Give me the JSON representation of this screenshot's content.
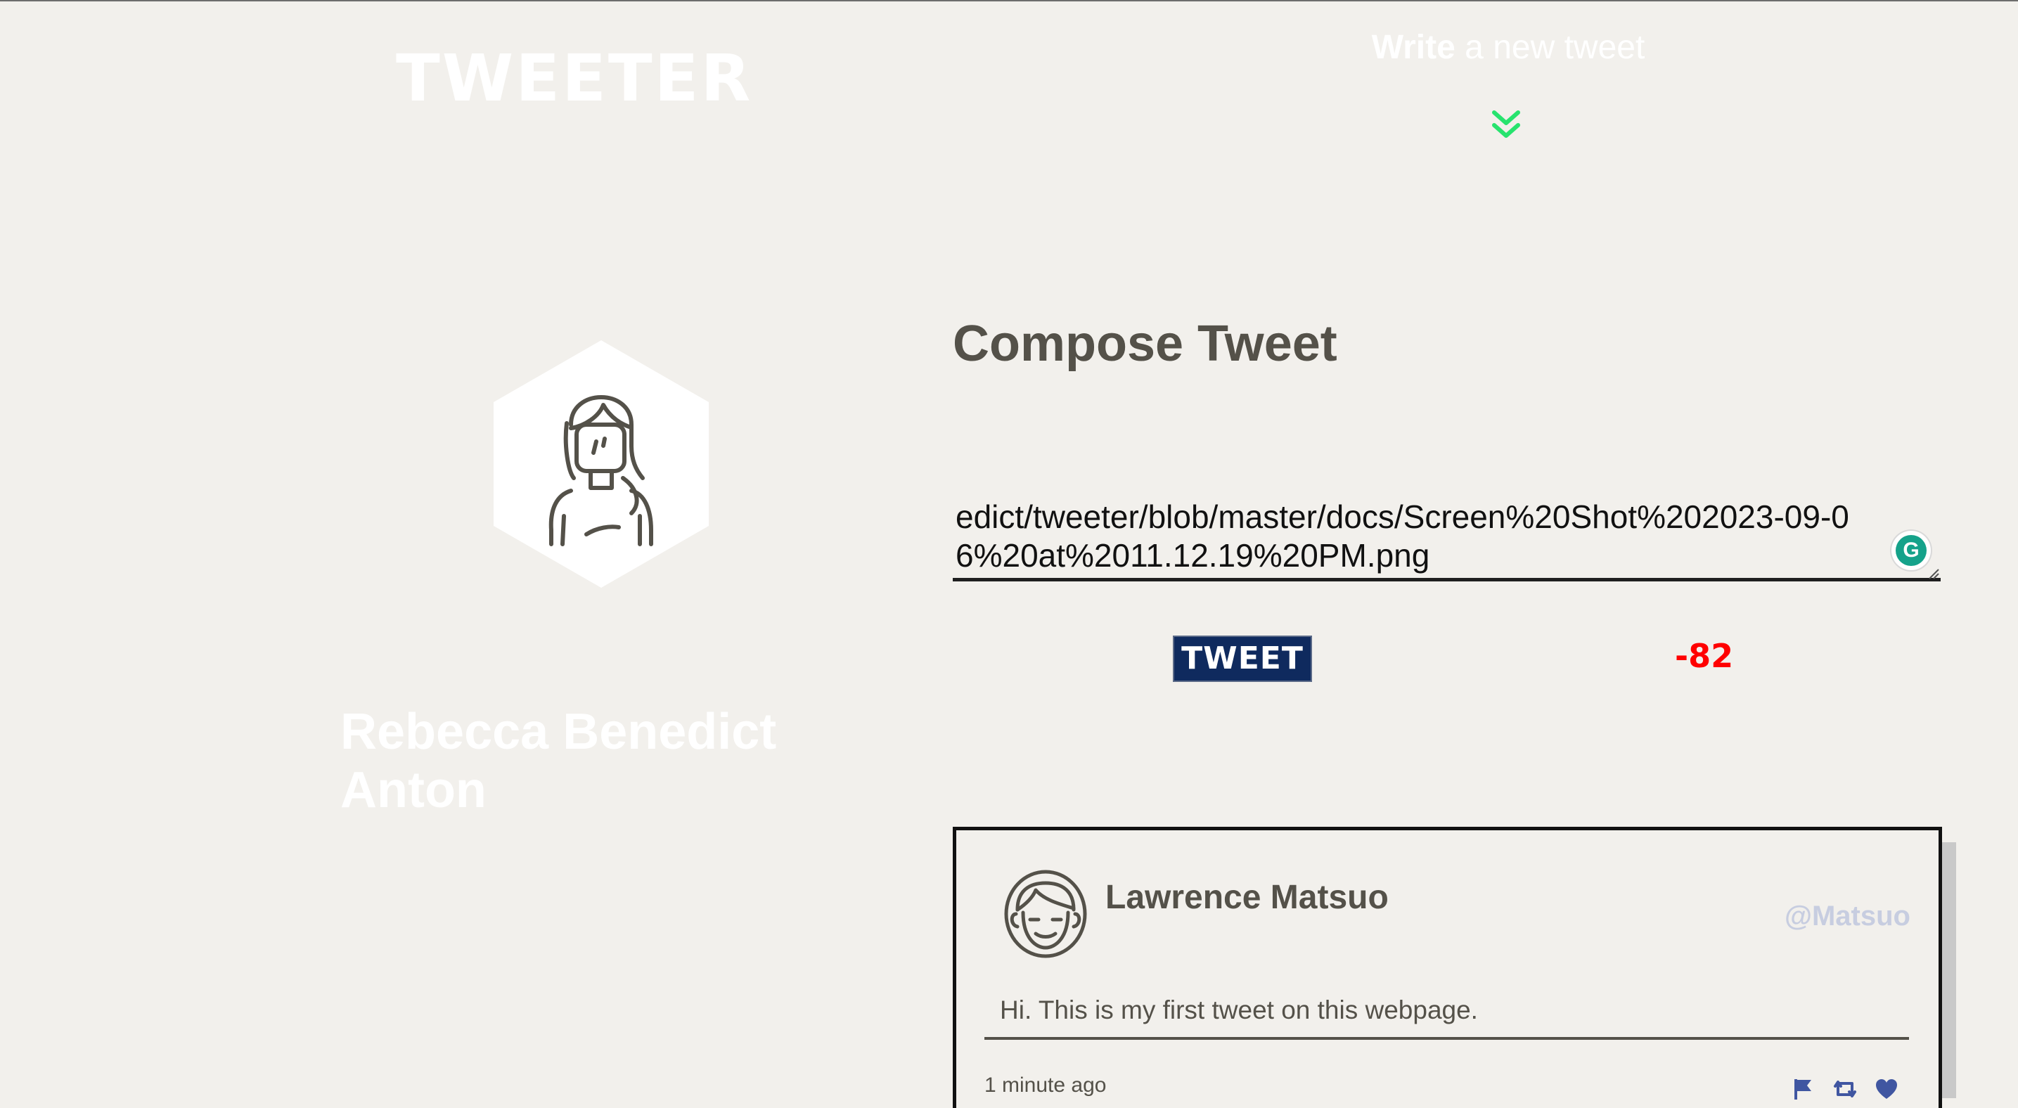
{
  "header": {
    "brand": "TWEETER",
    "write_prefix": "Write",
    "write_rest": " a new tweet",
    "chevron_icon": "double-chevron-down-icon",
    "chevron_color": "#27e36e"
  },
  "profile": {
    "name": "Rebecca Benedict Anton",
    "avatar_icon": "woman-avatar-icon"
  },
  "compose": {
    "title": "Compose Tweet",
    "textarea_value": "edict/tweeter/blob/master/docs/Screen%20Shot%202023-09-06%20at%2011.12.19%20PM.png",
    "button_label": "TWEET",
    "counter": "-82",
    "counter_color": "#ff0000",
    "grammarly_icon": "grammarly-icon",
    "grammarly_glyph": "G"
  },
  "tweets": [
    {
      "author": "Lawrence Matsuo",
      "handle": "@Matsuo",
      "content": "Hi. This is my first tweet on this webpage.",
      "time_ago": "1 minute ago",
      "avatar_icon": "man-avatar-icon",
      "action_icons": [
        "flag-icon",
        "retweet-icon",
        "heart-icon"
      ],
      "action_color": "#4056a1"
    }
  ]
}
